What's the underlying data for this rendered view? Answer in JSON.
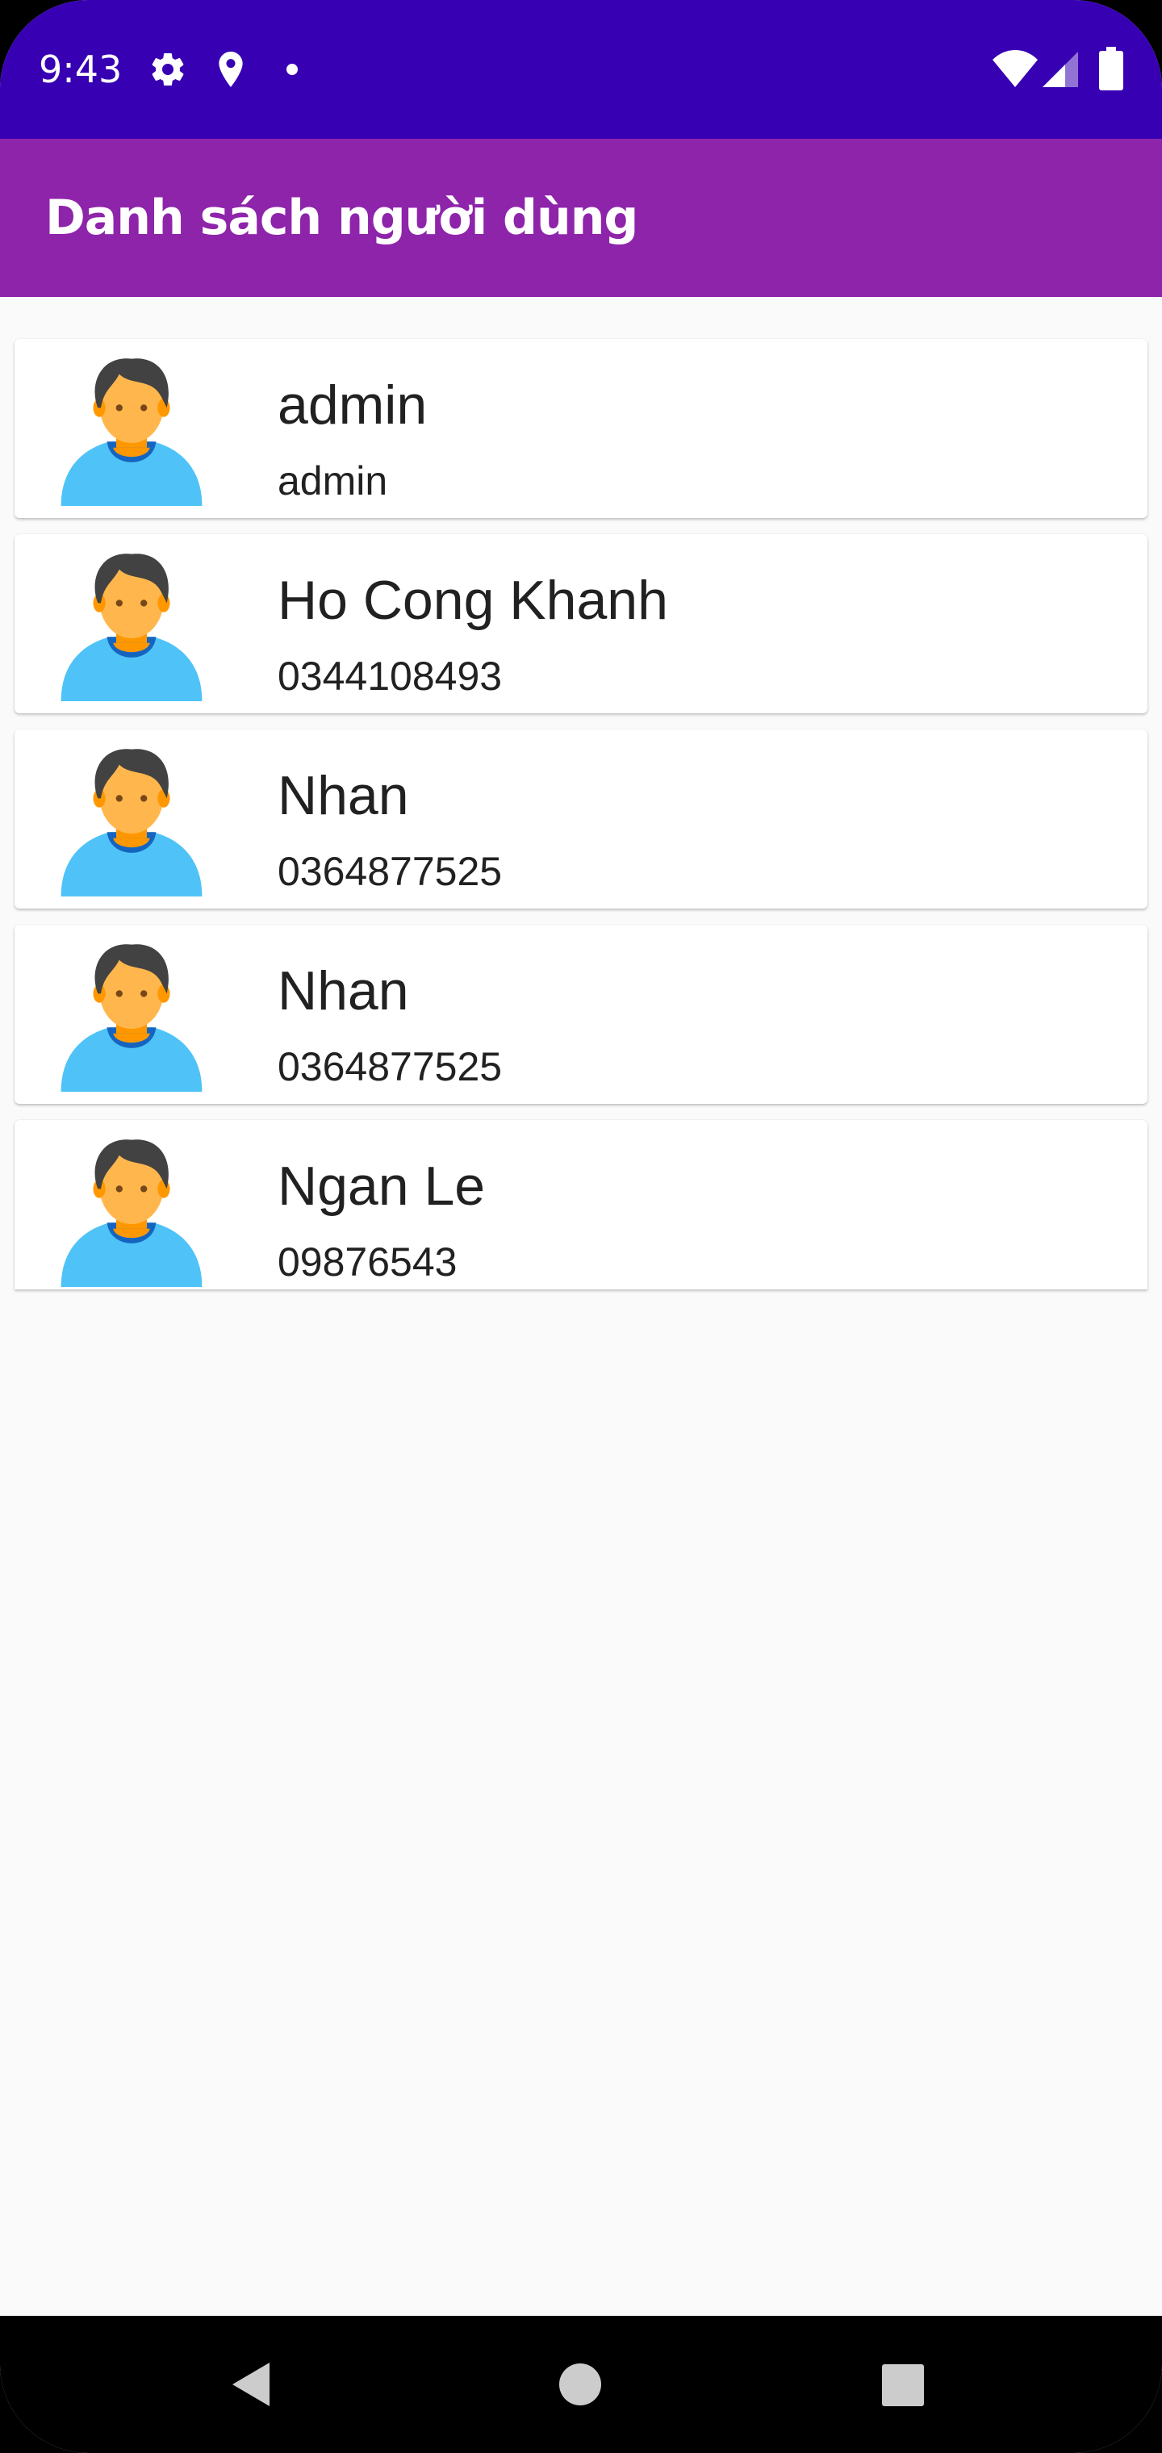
{
  "status_bar": {
    "time": "9:43",
    "icons": [
      "settings-icon",
      "location-icon",
      "notification-dot-icon",
      "wifi-icon",
      "signal-icon",
      "battery-icon"
    ],
    "background_color": "#3700b3"
  },
  "app_bar": {
    "title": "Danh sách người dùng",
    "background_color": "#8e24aa"
  },
  "users": [
    {
      "name": "admin",
      "phone": "admin",
      "avatar_icon": "user-avatar-icon"
    },
    {
      "name": "Ho Cong Khanh",
      "phone": "0344108493",
      "avatar_icon": "user-avatar-icon"
    },
    {
      "name": "Nhan",
      "phone": "0364877525",
      "avatar_icon": "user-avatar-icon"
    },
    {
      "name": "Nhan",
      "phone": "0364877525",
      "avatar_icon": "user-avatar-icon"
    },
    {
      "name": "Ngan Le",
      "phone": "09876543",
      "avatar_icon": "user-avatar-icon"
    }
  ],
  "nav_bar": {
    "buttons": [
      "back-icon",
      "home-icon",
      "recents-icon"
    ]
  }
}
